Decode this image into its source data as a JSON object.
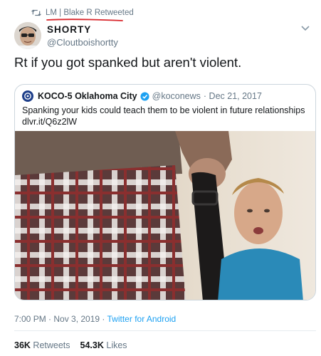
{
  "retweet": {
    "label": "LM | Blake R Retweeted",
    "icon": "retweet-icon"
  },
  "author": {
    "display_name": "SHORTY",
    "handle": "@Cloutboishortty",
    "avatar": "avatar"
  },
  "tweet": {
    "text": "Rt if you got spanked but aren't violent."
  },
  "quoted": {
    "name": "KOCO-5 Oklahoma City",
    "handle": "@koconews",
    "date": "· Dec 21, 2017",
    "text": "Spanking your kids could teach them to be violent in future relationships",
    "link": "dlvr.it/Q6z2lW",
    "image": "photo of adult holding a belt next to a young child"
  },
  "meta": {
    "time": "7:00 PM · Nov 3, 2019 · ",
    "source": "Twitter for Android"
  },
  "stats": {
    "retweets_count": "36K",
    "retweets_label": "Retweets",
    "likes_count": "54.3K",
    "likes_label": "Likes"
  },
  "colors": {
    "link_blue": "#1da1f2",
    "muted_gray": "#657786",
    "annotation_red": "#d9262b"
  }
}
